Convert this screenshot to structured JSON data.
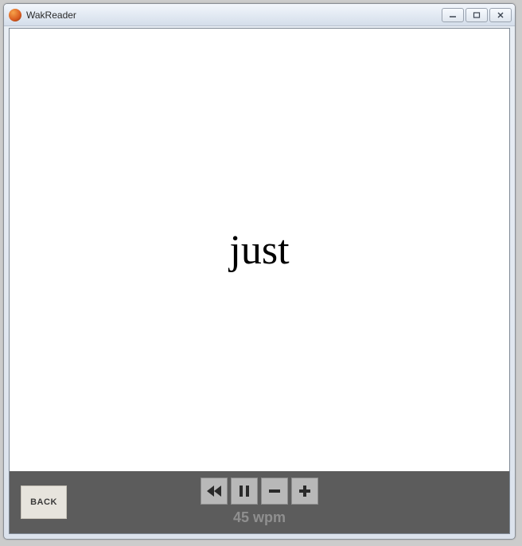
{
  "window": {
    "title": "WakReader",
    "icon": "app-icon"
  },
  "reader": {
    "current_word": "just"
  },
  "controls": {
    "back_label": "BACK",
    "wpm_text": "45 wpm",
    "icons": {
      "rewind": "rewind-icon",
      "pause": "pause-icon",
      "minus": "minus-icon",
      "plus": "plus-icon"
    }
  },
  "window_controls": {
    "minimize": "minimize-icon",
    "maximize": "maximize-icon",
    "close": "close-icon"
  }
}
